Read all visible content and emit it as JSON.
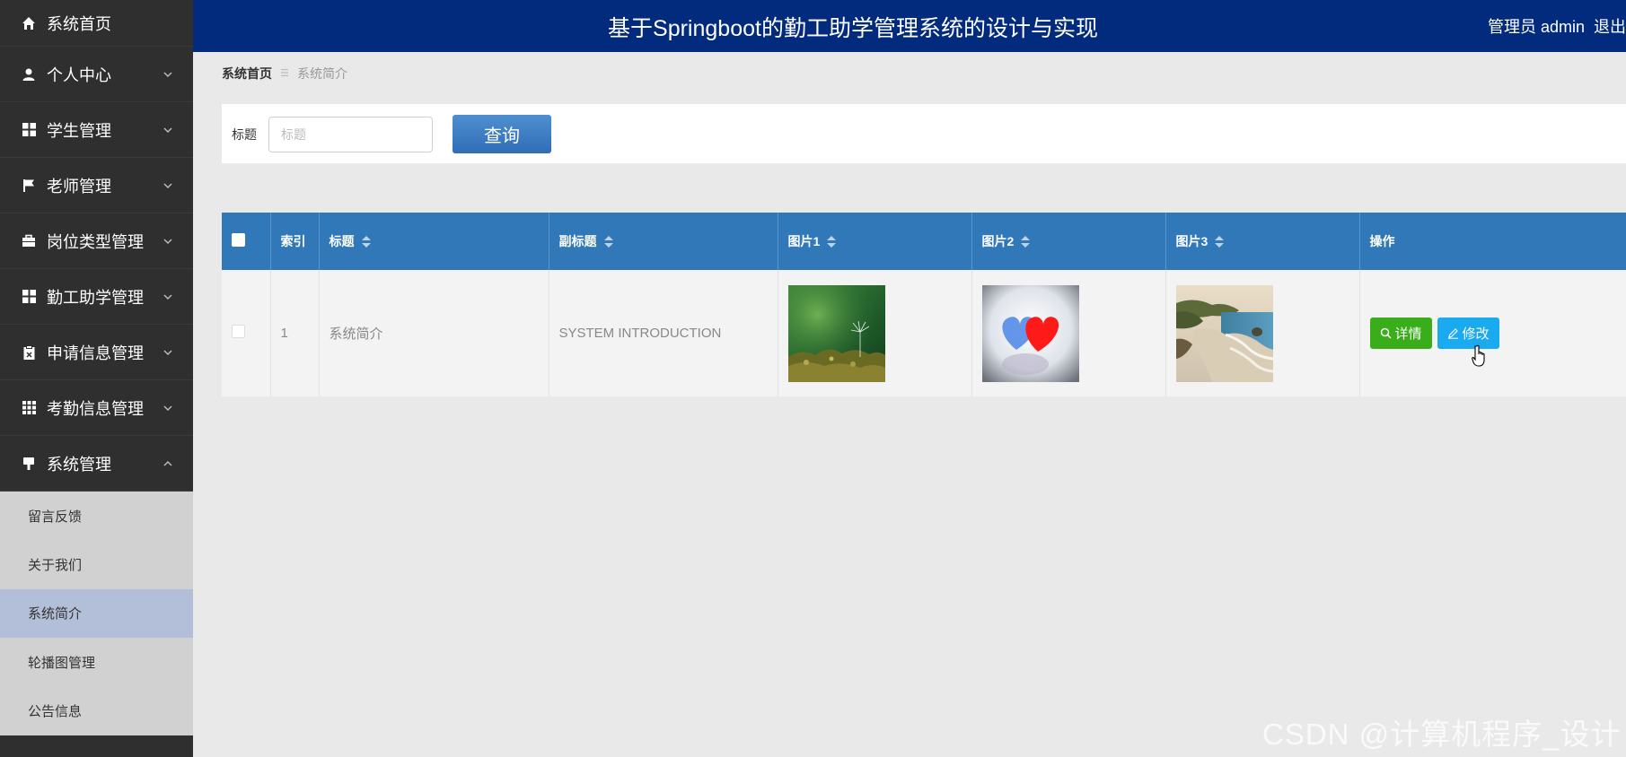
{
  "app": {
    "title": "基于Springboot的勤工助学管理系统的设计与实现",
    "user": "管理员 admin",
    "logout": "退出"
  },
  "sidebar": {
    "items": [
      {
        "label": "系统首页",
        "icon": "home-icon"
      },
      {
        "label": "个人中心",
        "icon": "user-icon"
      },
      {
        "label": "学生管理",
        "icon": "grid-icon"
      },
      {
        "label": "老师管理",
        "icon": "flag-icon"
      },
      {
        "label": "岗位类型管理",
        "icon": "briefcase-icon"
      },
      {
        "label": "勤工助学管理",
        "icon": "grid-icon"
      },
      {
        "label": "申请信息管理",
        "icon": "clipboard-icon"
      },
      {
        "label": "考勤信息管理",
        "icon": "table-icon"
      },
      {
        "label": "系统管理",
        "icon": "cog-icon"
      }
    ],
    "submenu": [
      {
        "label": "留言反馈"
      },
      {
        "label": "关于我们"
      },
      {
        "label": "系统简介",
        "active": true
      },
      {
        "label": "轮播图管理"
      },
      {
        "label": "公告信息"
      }
    ]
  },
  "breadcrumb": {
    "home": "系统首页",
    "current": "系统简介"
  },
  "search": {
    "label": "标题",
    "placeholder": "标题",
    "value": "",
    "button": "查询"
  },
  "table": {
    "columns": [
      "索引",
      "标题",
      "副标题",
      "图片1",
      "图片2",
      "图片3",
      "操作"
    ],
    "rows": [
      {
        "index": "1",
        "title": "系统简介",
        "subtitle": "SYSTEM INTRODUCTION",
        "images": [
          "dandelion-moss-photo",
          "blue-red-hearts-photo",
          "coastal-beach-photo"
        ],
        "actions": {
          "detail": "详情",
          "edit": "修改"
        }
      }
    ]
  },
  "watermark": "CSDN @计算机程序_设计",
  "colors": {
    "header": "#022a7d",
    "sidebar": "#2f2f2f",
    "table_header": "#3178b8",
    "detail_button": "#3aad1b",
    "edit_button": "#19aaf0",
    "query_button": "#3b7cc4"
  }
}
